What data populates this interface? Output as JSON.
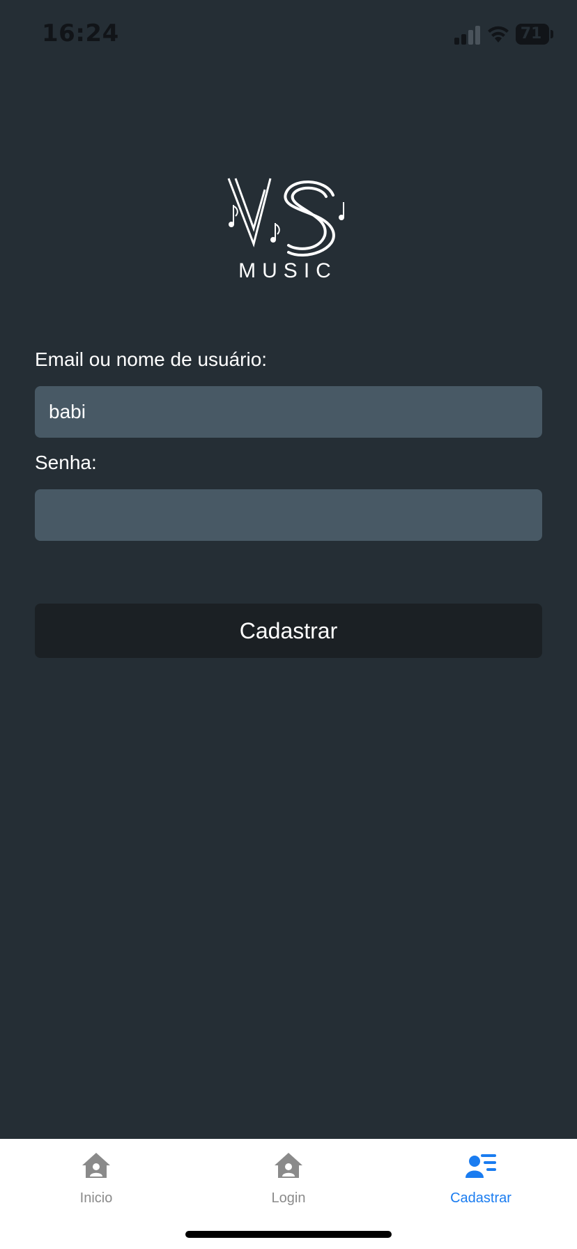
{
  "status_bar": {
    "time": "16:24",
    "battery": "71",
    "icons": [
      "signal-icon",
      "wifi-icon",
      "battery-icon"
    ]
  },
  "logo": {
    "text": "MUSIC",
    "monogram": "VS"
  },
  "form": {
    "email_label": "Email ou nome de usuário:",
    "email_value": "babi",
    "password_label": "Senha:",
    "password_value": "",
    "submit_label": "Cadastrar"
  },
  "tab_bar": {
    "items": [
      {
        "label": "Inicio",
        "icon": "home-icon",
        "active": false
      },
      {
        "label": "Login",
        "icon": "home-icon",
        "active": false
      },
      {
        "label": "Cadastrar",
        "icon": "user-list-icon",
        "active": true
      }
    ]
  },
  "colors": {
    "background": "#252e35",
    "input": "#485965",
    "button": "#1b2024",
    "tab_active": "#1a7cf0",
    "tab_inactive": "#8a8a8a"
  }
}
